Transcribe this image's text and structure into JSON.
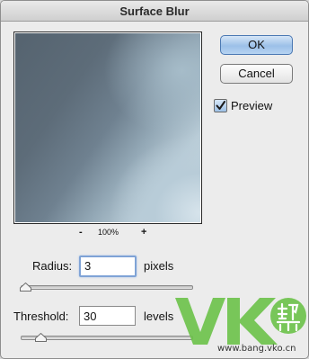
{
  "dialog": {
    "title": "Surface Blur"
  },
  "preview": {
    "zoom_minus": "-",
    "zoom_level": "100%",
    "zoom_plus": "+"
  },
  "buttons": {
    "ok_label": "OK",
    "cancel_label": "Cancel"
  },
  "preview_checkbox": {
    "label": "Preview",
    "checked": true
  },
  "radius": {
    "label": "Radius:",
    "value": "3",
    "unit": "pixels"
  },
  "threshold": {
    "label": "Threshold:",
    "value": "30",
    "unit": "levels"
  },
  "watermark": {
    "logo_text": "VK帮",
    "url": "www.bang.vko.cn",
    "color": "#6cc24a"
  },
  "colors": {
    "ok_button": "#9cc0e8",
    "focus_ring": "#7fa3d6",
    "dialog_bg": "#ececec"
  }
}
